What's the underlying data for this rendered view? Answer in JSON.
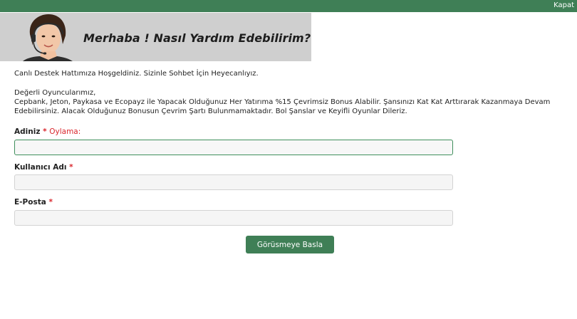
{
  "header": {
    "close_label": "Kapat"
  },
  "banner": {
    "title": "Merhaba ! Nasıl Yardım Edebilirim?"
  },
  "intro": {
    "welcome": "Canlı Destek Hattımıza Hoşgeldiniz. Sizinle Sohbet İçin Heyecanlıyız.",
    "greeting": "Değerli Oyuncularımız,",
    "message": "Cepbank, Jeton, Paykasa ve Ecopayz ile Yapacak Olduğunuz Her Yatırıma %15 Çevrimsiz Bonus Alabilir. Şansınızı Kat Kat Arttırarak Kazanmaya Devam Edebilirsiniz. Alacak Olduğunuz Bonusun Çevrim Şartı Bulunmamaktadır. Bol Şanslar ve Keyifli Oyunlar Dileriz."
  },
  "form": {
    "required_mark": "*",
    "name": {
      "label": "Adiniz",
      "hint": "Oylama:",
      "value": ""
    },
    "username": {
      "label": "Kullanıcı Adı",
      "value": ""
    },
    "email": {
      "label": "E-Posta",
      "value": ""
    },
    "submit_label": "Görüsmeye Basla"
  },
  "colors": {
    "accent": "#3f7f56",
    "banner_bg": "#cfcfcf",
    "required": "#d9262c"
  },
  "icons": {
    "avatar": "support-agent-headset-icon"
  }
}
